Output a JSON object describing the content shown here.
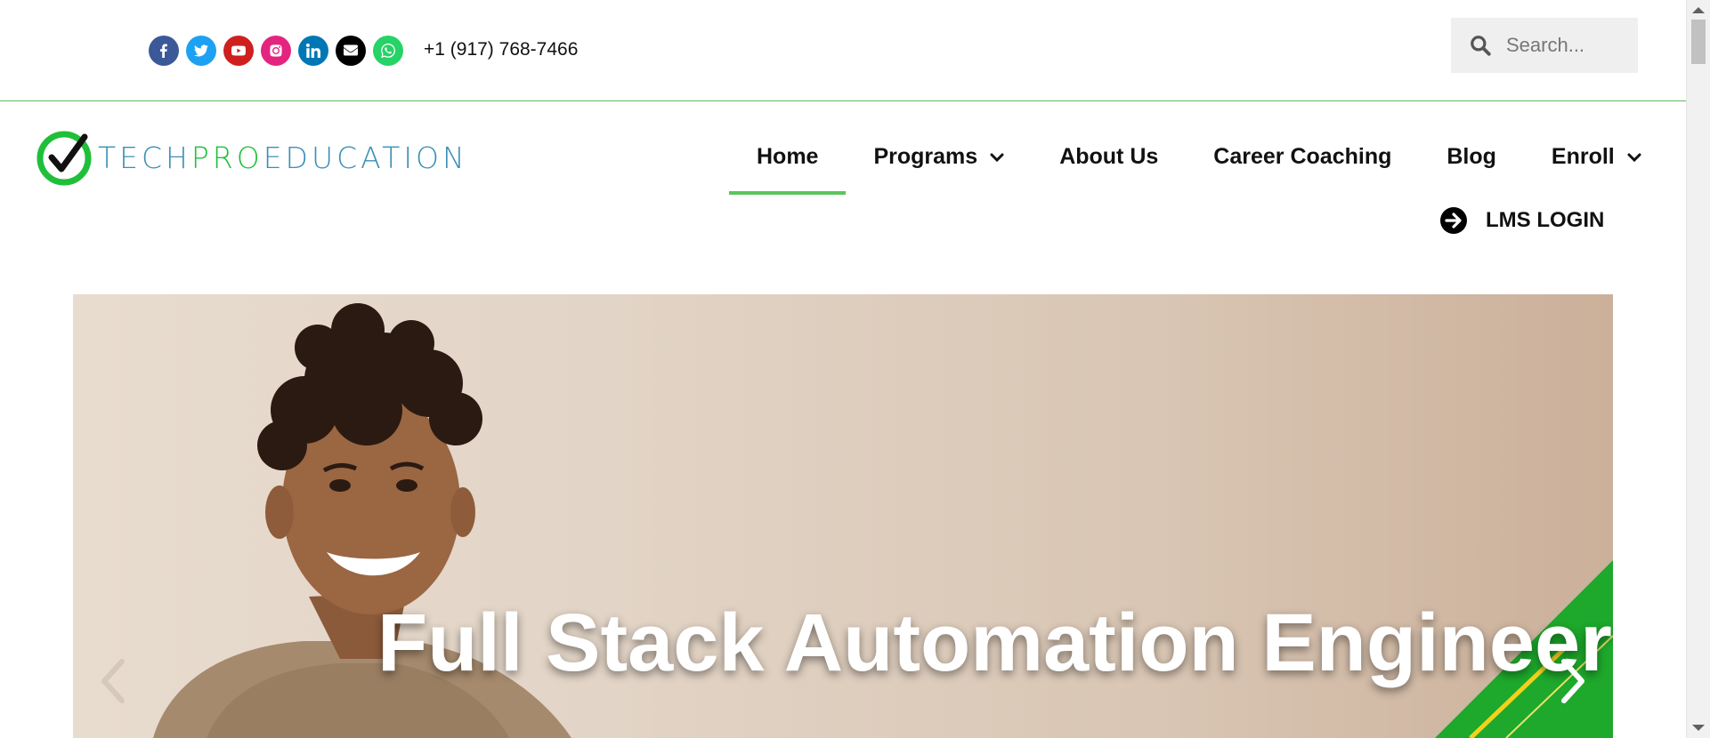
{
  "topbar": {
    "phone": "+1 (917) 768-7466",
    "social_icons": [
      {
        "name": "facebook-icon",
        "color": "#3b5998"
      },
      {
        "name": "twitter-icon",
        "color": "#1da1f2"
      },
      {
        "name": "youtube-icon",
        "color": "#cd201f"
      },
      {
        "name": "instagram-icon",
        "color": "#e4257f"
      },
      {
        "name": "linkedin-icon",
        "color": "#0077b5"
      },
      {
        "name": "envelope-icon",
        "color": "#000000"
      },
      {
        "name": "whatsapp-icon",
        "color": "#25d366"
      }
    ]
  },
  "search": {
    "placeholder": "Search...",
    "icon": "search-icon"
  },
  "logo": {
    "part1": "TECH",
    "part2": "PRO",
    "part3": "EDUCATION"
  },
  "nav": {
    "items": [
      {
        "label": "Home",
        "active": true
      },
      {
        "label": "Programs",
        "dropdown": true
      },
      {
        "label": "About Us"
      },
      {
        "label": "Career Coaching"
      },
      {
        "label": "Blog"
      },
      {
        "label": "Enroll",
        "dropdown": true
      }
    ],
    "lms_label": "LMS LOGIN"
  },
  "hero": {
    "title": "Full Stack Automation Engineer",
    "prev_icon": "chevron-left-icon",
    "next_icon": "chevron-right-icon"
  },
  "colors": {
    "accent_green": "#5cc55c",
    "logo_blue": "#3a8fb7",
    "logo_green": "#1fbf3a"
  }
}
